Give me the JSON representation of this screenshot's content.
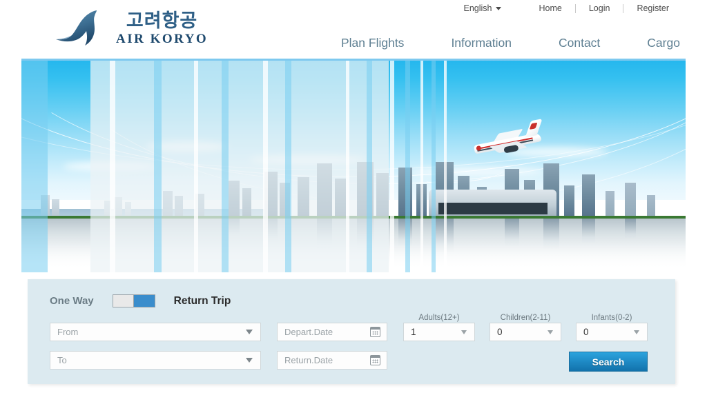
{
  "topbar": {
    "language": "English",
    "links": [
      "Home",
      "Login",
      "Register"
    ]
  },
  "logo": {
    "korean": "고려항공",
    "english": "AIR KORYO"
  },
  "mainnav": {
    "items": [
      "Plan Flights",
      "Information",
      "Contact",
      "Cargo"
    ]
  },
  "booking": {
    "one_way_label": "One Way",
    "return_trip_label": "Return Trip",
    "trip_type_selected": "Return Trip",
    "from_placeholder": "From",
    "to_placeholder": "To",
    "depart_placeholder": "Depart.Date",
    "return_placeholder": "Return.Date",
    "adults_label": "Adults(12+)",
    "children_label": "Children(2-11)",
    "infants_label": "Infants(0-2)",
    "adults_value": "1",
    "children_value": "0",
    "infants_value": "0",
    "search_label": "Search"
  },
  "colors": {
    "accent_blue": "#1f8bc6",
    "toggle_on": "#3a8dcc",
    "panel_bg": "#dceaf0",
    "nav_text": "#5e7f92",
    "logo_blue": "#2e5f86"
  }
}
